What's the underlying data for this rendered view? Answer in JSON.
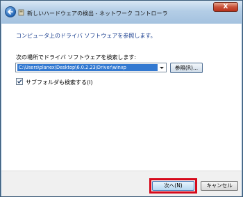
{
  "window": {
    "title": "新しいハードウェアの検出 - ネットワーク コントローラ",
    "close_label": "X"
  },
  "main": {
    "heading": "コンピュータ上のドライバ ソフトウェアを参照します。",
    "search_label": "次の場所でドライバ ソフトウェアを検索します:",
    "path_value": "C:\\Users\\planex\\Desktop\\6.0.2.23\\Driver\\winxp",
    "browse_label": "参照(R)...",
    "subfolder_label": "サブフォルダも検索する(I)",
    "subfolder_checked": true
  },
  "footer": {
    "next_label": "次へ(N)",
    "cancel_label": "キャンセル"
  },
  "colors": {
    "heading": "#1b3f8f",
    "highlight": "#d6091b",
    "selection": "#3379d1"
  }
}
